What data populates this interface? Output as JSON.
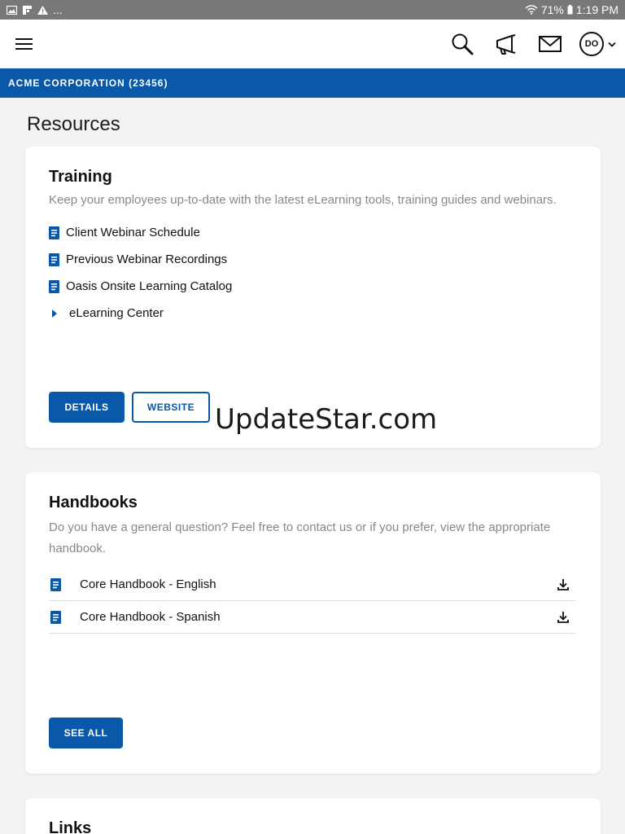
{
  "statusbar": {
    "battery": "71%",
    "time": "1:19 PM",
    "more": "..."
  },
  "colors": {
    "brand": "#0a58a8",
    "statusbar": "#787878",
    "muted_text": "#888888"
  },
  "icons": [
    "menu-icon",
    "search-icon",
    "megaphone-icon",
    "mail-icon",
    "chevron-down-icon",
    "document-icon",
    "play-icon",
    "download-icon"
  ],
  "header": {
    "avatar_initials": "DO"
  },
  "org": {
    "name": "ACME CORPORATION (23456)"
  },
  "page": {
    "title": "Resources"
  },
  "training": {
    "title": "Training",
    "description": "Keep your employees up-to-date with the latest eLearning tools, training guides and webinars.",
    "links": [
      {
        "label": "Client Webinar Schedule"
      },
      {
        "label": "Previous Webinar Recordings"
      },
      {
        "label": "Oasis Onsite Learning Catalog"
      },
      {
        "label": "eLearning Center"
      }
    ],
    "details_label": "DETAILS",
    "website_label": "WEBSITE"
  },
  "watermark": "UpdateStar.com",
  "handbooks": {
    "title": "Handbooks",
    "description": "Do you have a general question? Feel free to contact us or if you prefer, view the appropriate handbook.",
    "items": [
      {
        "label": "Core Handbook - English"
      },
      {
        "label": "Core Handbook - Spanish"
      }
    ],
    "see_all_label": "SEE ALL"
  },
  "links": {
    "title": "Links"
  }
}
